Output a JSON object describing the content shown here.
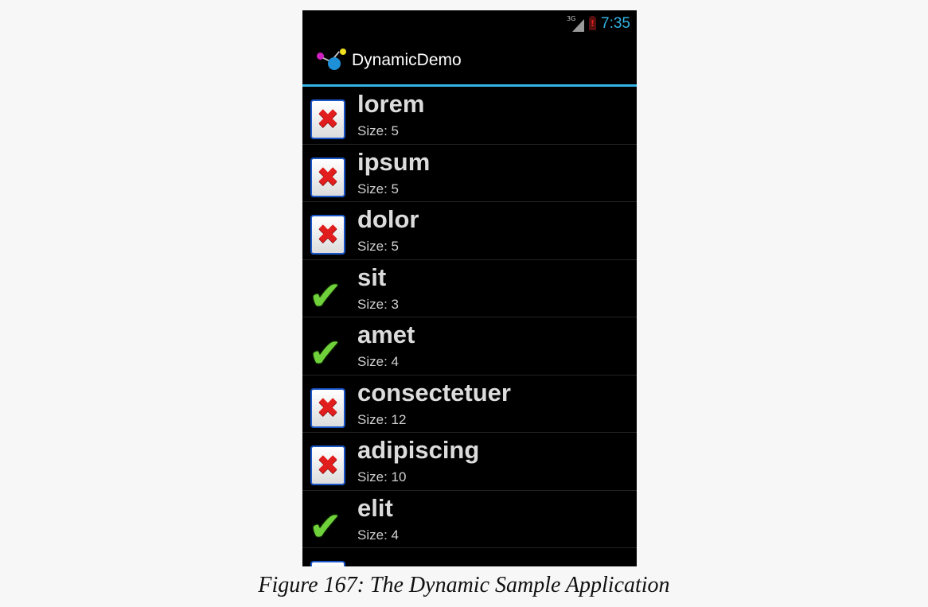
{
  "status_bar": {
    "network_label": "3G",
    "signal_icon": "signal-bars-icon",
    "battery_icon": "battery-low-icon",
    "time": "7:35"
  },
  "action_bar": {
    "app_icon": "molecule-app-icon",
    "title": "DynamicDemo"
  },
  "list": {
    "items": [
      {
        "word": "lorem",
        "size": "Size: 5",
        "icon": "delete-x-icon"
      },
      {
        "word": "ipsum",
        "size": "Size: 5",
        "icon": "delete-x-icon"
      },
      {
        "word": "dolor",
        "size": "Size: 5",
        "icon": "delete-x-icon"
      },
      {
        "word": "sit",
        "size": "Size: 3",
        "icon": "checkmark-icon"
      },
      {
        "word": "amet",
        "size": "Size: 4",
        "icon": "checkmark-icon"
      },
      {
        "word": "consectetuer",
        "size": "Size: 12",
        "icon": "delete-x-icon"
      },
      {
        "word": "adipiscing",
        "size": "Size: 10",
        "icon": "delete-x-icon"
      },
      {
        "word": "elit",
        "size": "Size: 4",
        "icon": "checkmark-icon"
      },
      {
        "word": "",
        "size": "",
        "icon": "delete-x-icon"
      }
    ]
  },
  "colors": {
    "accent": "#33b5e5",
    "check": "#6fd23a",
    "x_red": "#e21d1d"
  },
  "caption": "Figure 167: The Dynamic Sample Application"
}
